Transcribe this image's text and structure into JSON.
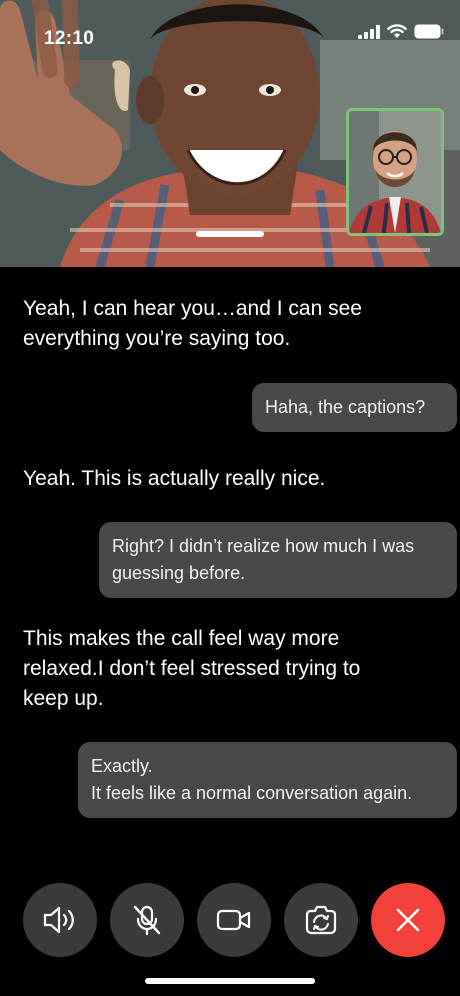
{
  "status_bar": {
    "time": "12:10"
  },
  "transcript": {
    "messages": [
      {
        "sender": "remote",
        "text": "Yeah, I can hear you…and I can see everything you’re saying too."
      },
      {
        "sender": "self",
        "text": "Haha, the captions?"
      },
      {
        "sender": "remote",
        "text": "Yeah. This is actually really nice."
      },
      {
        "sender": "self",
        "text": "Right? I didn’t realize how much I was guessing before."
      },
      {
        "sender": "remote",
        "text": "This makes the call feel way more relaxed.I don’t feel stressed trying to keep up."
      },
      {
        "sender": "self",
        "text": "Exactly.\nIt feels like a normal conversation again."
      }
    ]
  },
  "controls": {
    "buttons": [
      {
        "name": "speaker",
        "icon": "speaker-icon"
      },
      {
        "name": "mute",
        "icon": "mic-off-icon"
      },
      {
        "name": "video",
        "icon": "video-camera-icon"
      },
      {
        "name": "flip-camera",
        "icon": "flip-camera-icon"
      },
      {
        "name": "end-call",
        "icon": "close-icon"
      }
    ],
    "end_call_color": "#f2403a",
    "button_color": "#3b3b3b"
  },
  "pip_border_color": "#7fc27a"
}
